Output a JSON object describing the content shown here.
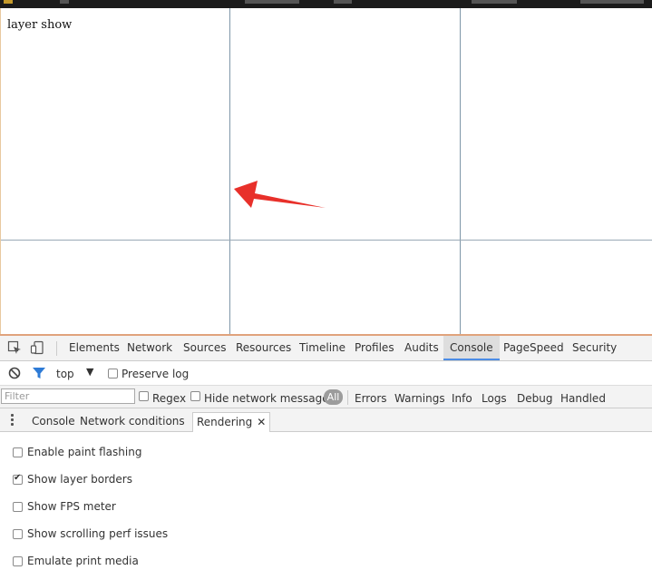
{
  "page": {
    "text": "layer show"
  },
  "devtools": {
    "tabs": [
      {
        "label": "Elements"
      },
      {
        "label": "Network"
      },
      {
        "label": "Sources"
      },
      {
        "label": "Resources"
      },
      {
        "label": "Timeline"
      },
      {
        "label": "Profiles"
      },
      {
        "label": "Audits"
      },
      {
        "label": "Console",
        "active": true
      },
      {
        "label": "PageSpeed"
      },
      {
        "label": "Security"
      }
    ],
    "console_bar": {
      "context": "top",
      "preserve_log": "Preserve log"
    },
    "filter_bar": {
      "filter_placeholder": "Filter",
      "regex": "Regex",
      "hide_network": "Hide network messages",
      "all": "All",
      "levels": [
        "Errors",
        "Warnings",
        "Info",
        "Logs",
        "Debug",
        "Handled"
      ]
    },
    "drawer": {
      "tabs": [
        "Console",
        "Network conditions",
        "Rendering"
      ],
      "active": "Rendering"
    },
    "rendering_options": [
      {
        "label": "Enable paint flashing",
        "checked": false
      },
      {
        "label": "Show layer borders",
        "checked": true
      },
      {
        "label": "Show FPS meter",
        "checked": false
      },
      {
        "label": "Show scrolling perf issues",
        "checked": false
      },
      {
        "label": "Emulate print media",
        "checked": false
      }
    ]
  },
  "colors": {
    "accent": "#4c8ce6",
    "arrow": "#e8302a",
    "layer_border": "#7f96a8"
  },
  "icons": [
    "inspect-icon",
    "device-icon",
    "clear-console-icon",
    "filter-icon",
    "dropdown-icon",
    "kebab-menu-icon",
    "close-icon",
    "arrow-annotation"
  ]
}
